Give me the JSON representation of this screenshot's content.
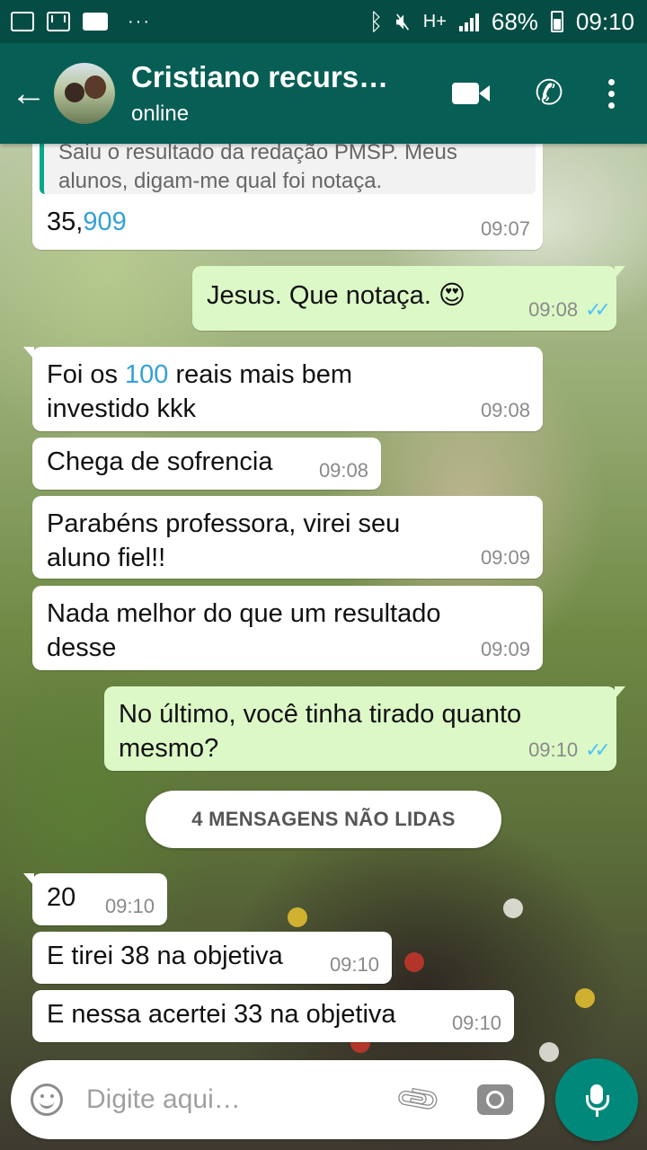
{
  "status_bar": {
    "network": "H+",
    "battery": "68%",
    "time": "09:10"
  },
  "header": {
    "contact_name": "Cristiano recurso…",
    "status": "online"
  },
  "messages": [
    {
      "direction": "in",
      "quote": "Saiu o resultado da redação PMSP. Meus alunos, digam-me qual foi notaça.",
      "text_prefix": "35,",
      "text_link": "909",
      "time": "09:07"
    },
    {
      "direction": "out",
      "text": "Jesus. Que notaça. 😍",
      "time": "09:08",
      "read": true
    },
    {
      "direction": "in",
      "text_before": "Foi os ",
      "text_link": "100",
      "text_after": " reais mais bem investido kkk",
      "time": "09:08"
    },
    {
      "direction": "in",
      "text": "Chega de sofrencia",
      "time": "09:08"
    },
    {
      "direction": "in",
      "text": "Parabéns professora, virei seu aluno fiel!!",
      "time": "09:09"
    },
    {
      "direction": "in",
      "text": "Nada melhor do que um resultado desse",
      "time": "09:09"
    },
    {
      "direction": "out",
      "text": "No último, você tinha tirado quanto mesmo?",
      "time": "09:10",
      "read": true
    },
    {
      "direction": "in",
      "text": "20",
      "time": "09:10"
    },
    {
      "direction": "in",
      "text": "E tirei 38 na objetiva",
      "time": "09:10"
    },
    {
      "direction": "in",
      "text": "E nessa acertei 33 na objetiva",
      "time": "09:10"
    }
  ],
  "unread_banner": "4 MENSAGENS NÃO LIDAS",
  "composer": {
    "placeholder": "Digite aqui…"
  },
  "icons": {
    "back": "arrow-back-icon",
    "video": "video-call-icon",
    "phone": "phone-icon",
    "menu": "more-vert-icon",
    "emoji": "emoji-icon",
    "attach": "paperclip-icon",
    "camera": "camera-icon",
    "mic": "mic-icon"
  },
  "colors": {
    "status_bar": "#054d44",
    "app_bar": "#075e54",
    "outgoing_bubble": "#dcf8c6",
    "incoming_bubble": "#ffffff",
    "read_ticks": "#4fc3f7",
    "mic_button": "#00897b"
  }
}
